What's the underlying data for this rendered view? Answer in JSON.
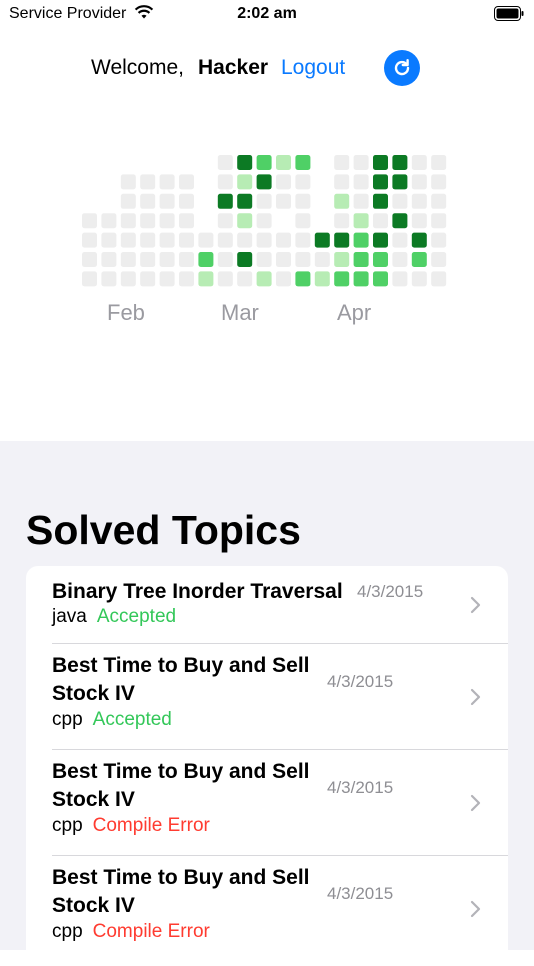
{
  "status_bar": {
    "carrier": "Service Provider",
    "time": "2:02 am",
    "wifi_icon": "wifi-icon",
    "battery_icon": "battery-icon"
  },
  "header": {
    "welcome": "Welcome,",
    "username": "Hacker",
    "logout": "Logout",
    "refresh_icon": "refresh-icon",
    "accent": "#0a7aff"
  },
  "heatmap": {
    "months": [
      "Feb",
      "Mar",
      "Apr"
    ],
    "colors": {
      "empty": "#ededed",
      "light": "#b7ecb4",
      "medium": "#4fd066",
      "dark": "#2aa43c",
      "darkest": "#0c7a24"
    }
  },
  "solved": {
    "title": "Solved Topics",
    "items": [
      {
        "title": "Binary Tree Inorder Traversal",
        "lang": "java",
        "status": "Accepted",
        "status_color": "#33c759",
        "date": "4/3/2015"
      },
      {
        "title": "Best Time to Buy and Sell Stock IV",
        "lang": "cpp",
        "status": "Accepted",
        "status_color": "#33c759",
        "date": "4/3/2015"
      },
      {
        "title": "Best Time to Buy and Sell Stock IV",
        "lang": "cpp",
        "status": "Compile Error",
        "status_color": "#ff3b30",
        "date": "4/3/2015"
      },
      {
        "title": "Best Time to Buy and Sell Stock IV",
        "lang": "cpp",
        "status": "Compile Error",
        "status_color": "#ff3b30",
        "date": "4/3/2015"
      }
    ]
  }
}
